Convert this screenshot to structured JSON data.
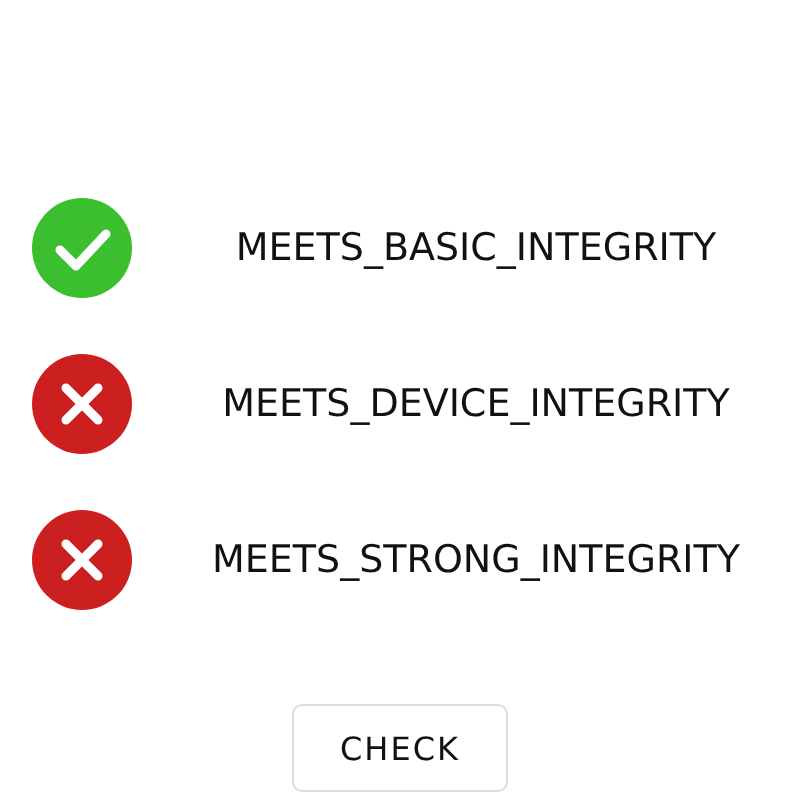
{
  "checks": [
    {
      "label": "MEETS_BASIC_INTEGRITY",
      "passed": true
    },
    {
      "label": "MEETS_DEVICE_INTEGRITY",
      "passed": false
    },
    {
      "label": "MEETS_STRONG_INTEGRITY",
      "passed": false
    }
  ],
  "button": "CHECK"
}
